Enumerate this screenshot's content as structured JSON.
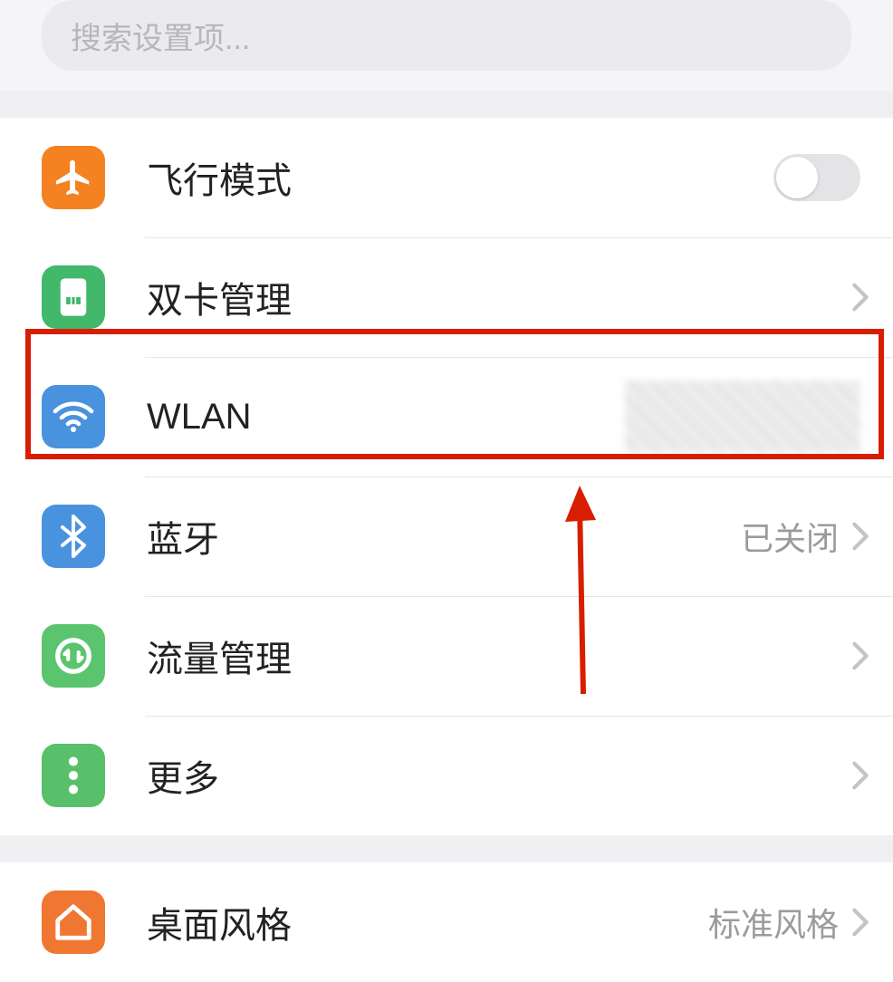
{
  "search": {
    "placeholder": "搜索设置项..."
  },
  "items": {
    "airplane": {
      "label": "飞行模式",
      "icon": "airplane-icon",
      "color": "#f58220"
    },
    "sim": {
      "label": "双卡管理",
      "icon": "sim-icon",
      "color": "#41b86a"
    },
    "wlan": {
      "label": "WLAN",
      "icon": "wifi-icon",
      "color": "#4993de"
    },
    "bluetooth": {
      "label": "蓝牙",
      "value": "已关闭",
      "icon": "bluetooth-icon",
      "color": "#4993de"
    },
    "data": {
      "label": "流量管理",
      "icon": "data-icon",
      "color": "#5bc46e"
    },
    "more": {
      "label": "更多",
      "icon": "more-icon",
      "color": "#58c06b"
    },
    "desktop": {
      "label": "桌面风格",
      "value": "标准风格",
      "icon": "home-icon",
      "color": "#f07731"
    }
  }
}
